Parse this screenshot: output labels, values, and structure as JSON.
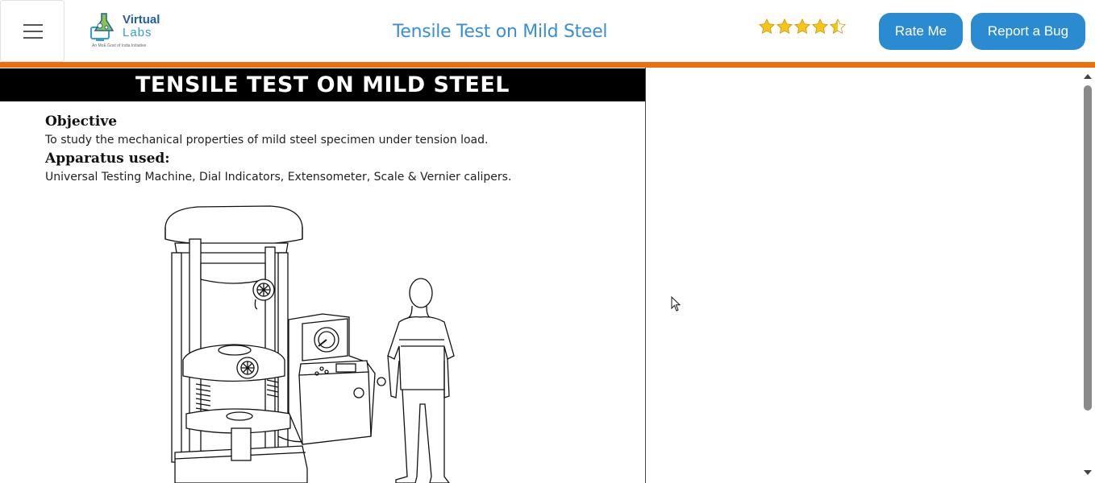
{
  "header": {
    "title": "Tensile Test on Mild Steel",
    "logo": {
      "line1": "Virtual",
      "line2": "Labs",
      "tagline": "An MoE Govt of India Initiative"
    },
    "rating": {
      "value": 4.5,
      "max": 5,
      "color": "#f5c518"
    },
    "rate_button": "Rate Me",
    "bug_button": "Report a Bug",
    "accent_color": "#ea6f0e",
    "button_color": "#2b8bd1"
  },
  "content": {
    "banner": "TENSILE TEST ON MILD STEEL",
    "objective_heading": "Objective",
    "objective_text": "To study the mechanical properties of mild steel specimen under tension load.",
    "apparatus_heading": "Apparatus used:",
    "apparatus_text": "Universal Testing Machine, Dial Indicators, Extensometer, Scale & Vernier calipers."
  }
}
